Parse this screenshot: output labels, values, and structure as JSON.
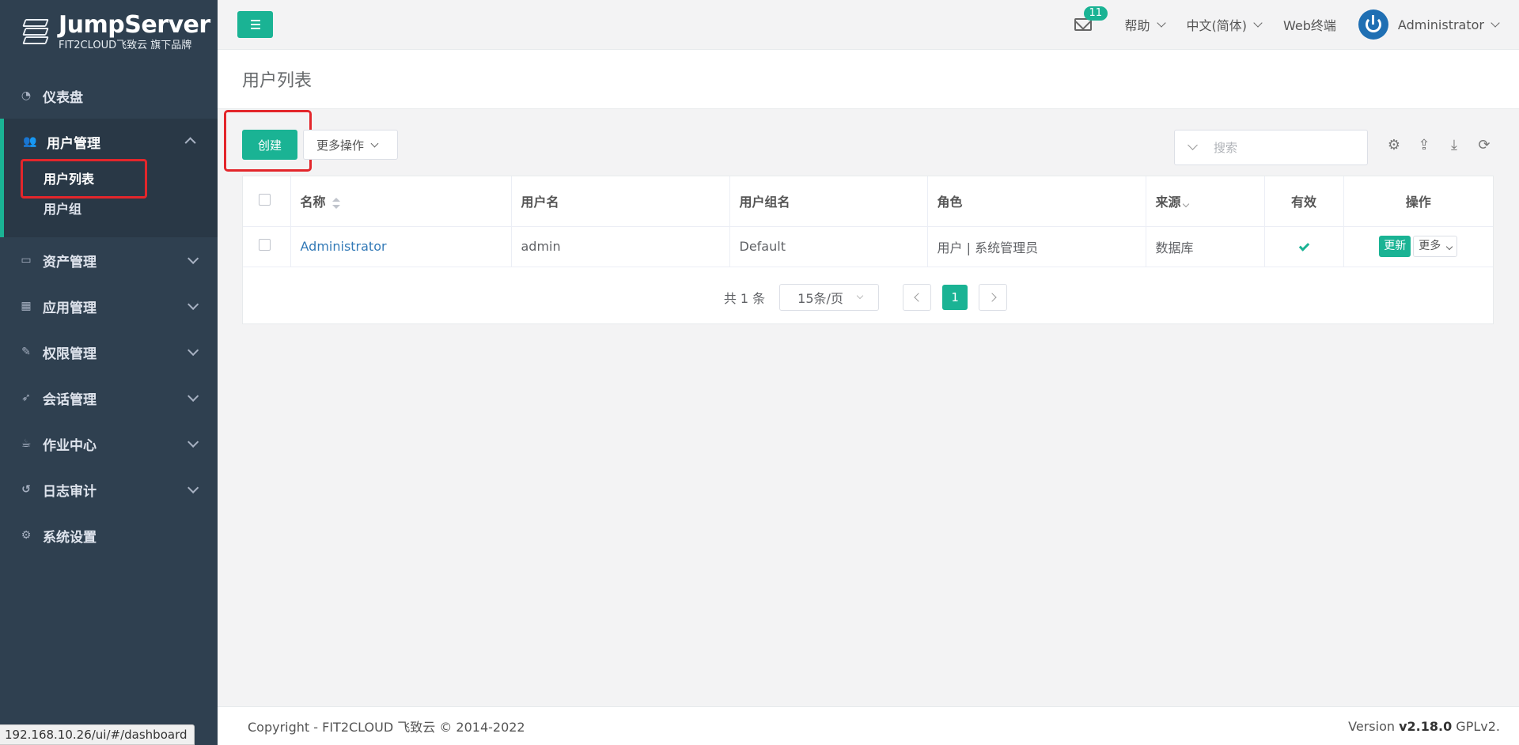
{
  "app": {
    "logo_title": "JumpServer",
    "logo_sub": "FIT2CLOUD飞致云 旗下品牌",
    "accent_color": "#1ab394",
    "sidebar_color": "#2f4050"
  },
  "sidebar": {
    "items": [
      {
        "label": "仪表盘",
        "icon": "dashboard-icon"
      },
      {
        "label": "用户管理",
        "icon": "users-icon",
        "expanded": true,
        "children": [
          {
            "label": "用户列表",
            "current": true
          },
          {
            "label": "用户组"
          }
        ]
      },
      {
        "label": "资产管理",
        "icon": "inbox-icon"
      },
      {
        "label": "应用管理",
        "icon": "grid-icon"
      },
      {
        "label": "权限管理",
        "icon": "edit-icon"
      },
      {
        "label": "会话管理",
        "icon": "rocket-icon"
      },
      {
        "label": "作业中心",
        "icon": "coffee-icon"
      },
      {
        "label": "日志审计",
        "icon": "history-icon"
      },
      {
        "label": "系统设置",
        "icon": "gears-icon"
      }
    ]
  },
  "topbar": {
    "mail_count": "11",
    "help": "帮助",
    "language": "中文(简体)",
    "web_terminal": "Web终端",
    "user": "Administrator"
  },
  "page": {
    "title": "用户列表"
  },
  "toolbar": {
    "create": "创建",
    "more_actions": "更多操作",
    "search_placeholder": "搜索"
  },
  "table": {
    "headers": [
      "名称",
      "用户名",
      "用户组名",
      "角色",
      "来源",
      "有效",
      "操作"
    ],
    "rows": [
      {
        "name": "Administrator",
        "username": "admin",
        "group": "Default",
        "role": "用户 | 系统管理员",
        "source": "数据库",
        "valid": true,
        "update": "更新",
        "more": "更多"
      }
    ]
  },
  "pagination": {
    "total": "共 1 条",
    "page_size": "15条/页",
    "current_page": "1"
  },
  "footer": {
    "copyright": "Copyright - FIT2CLOUD 飞致云 © 2014-2022",
    "version_prefix": "Version ",
    "version": "v2.18.0",
    "license": " GPLv2."
  },
  "statusbar": {
    "url": "192.168.10.26/ui/#/dashboard"
  }
}
